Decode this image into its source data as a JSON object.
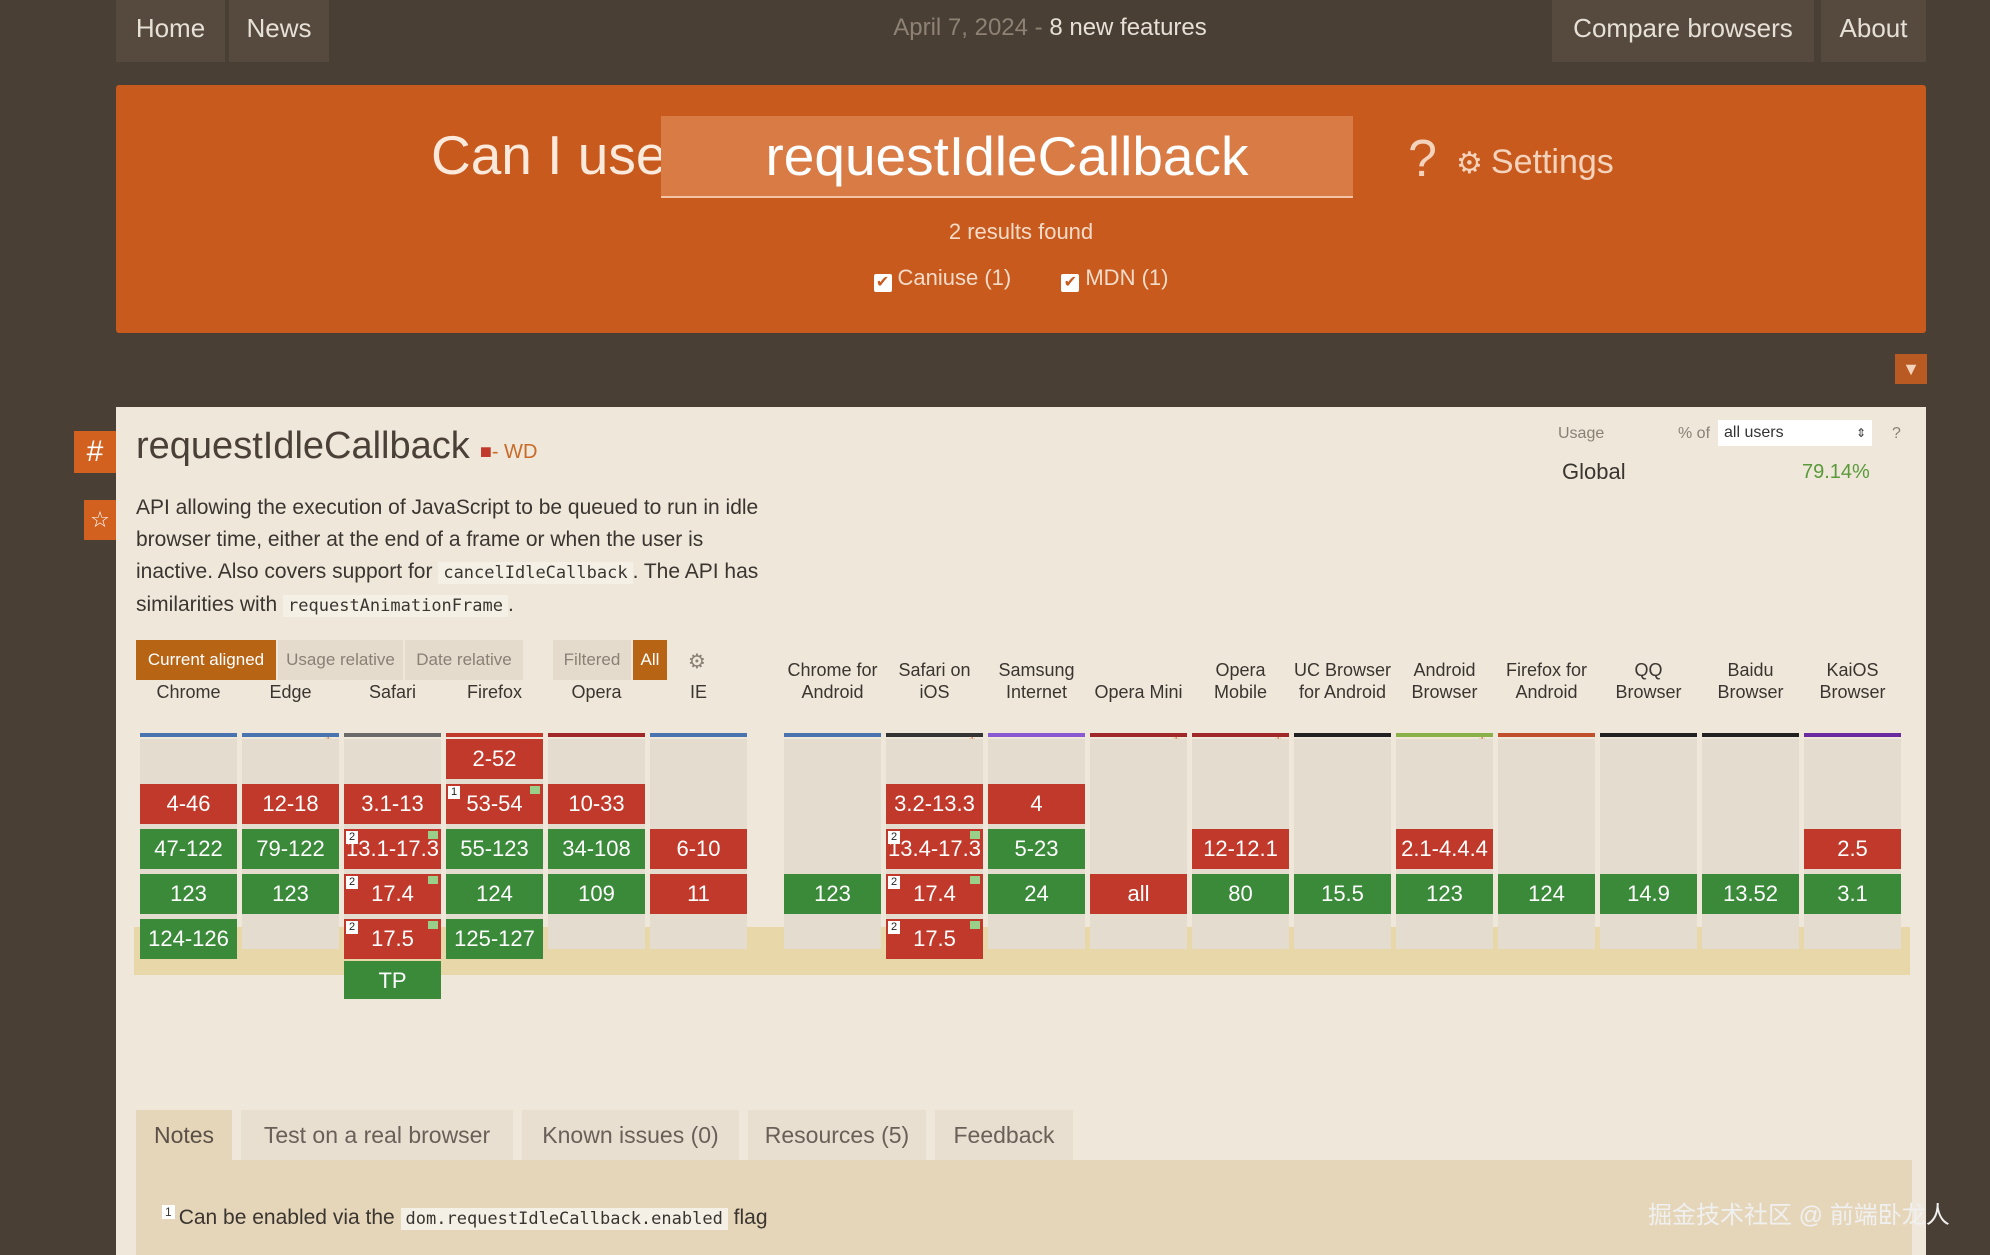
{
  "nav": {
    "home": "Home",
    "news": "News",
    "date": "April 7, 2024",
    "sep": " - ",
    "new_features": "8 new features",
    "compare": "Compare browsers",
    "about": "About"
  },
  "search": {
    "prefix": "Can I use",
    "query": "requestIdleCallback",
    "qmark": "?",
    "settings": "Settings",
    "results": "2 results found",
    "filters": [
      "Caniuse (1)",
      "MDN (1)"
    ]
  },
  "feature": {
    "title": "requestIdleCallback",
    "status": "- WD",
    "desc1": "API allowing the execution of JavaScript to be queued to run in idle browser time, either at the end of a frame or when the user is inactive. Also covers support for",
    "code1": "cancelIdleCallback",
    "desc2": ". The API has similarities with",
    "code2": "requestAnimationFrame",
    "desc3": "."
  },
  "usage": {
    "label": "Usage",
    "pct_of": "% of",
    "selector": "all users",
    "help": "?",
    "region": "Global",
    "value": "79.14%"
  },
  "view": {
    "current_aligned": "Current aligned",
    "usage_relative": "Usage relative",
    "date_relative": "Date relative",
    "filtered": "Filtered",
    "all": "All"
  },
  "browsers": [
    {
      "name": "Chrome",
      "star": false,
      "color": "#4a74b0"
    },
    {
      "name": "Edge",
      "star": true,
      "color": "#4a74b0"
    },
    {
      "name": "Safari",
      "star": false,
      "color": "#6a6a6a"
    },
    {
      "name": "Firefox",
      "star": false,
      "color": "#c0392b"
    },
    {
      "name": "Opera",
      "star": false,
      "color": "#a02828"
    },
    {
      "name": "IE",
      "star": false,
      "color": "#4a74b0"
    },
    {
      "name": "Chrome for Android",
      "star": false,
      "color": "#4a74b0"
    },
    {
      "name": "Safari on iOS",
      "star": true,
      "color": "#333333"
    },
    {
      "name": "Samsung Internet",
      "star": false,
      "color": "#8a5ad0"
    },
    {
      "name": "Opera Mini",
      "star": true,
      "color": "#a02828"
    },
    {
      "name": "Opera Mobile",
      "star": true,
      "color": "#a02828"
    },
    {
      "name": "UC Browser for Android",
      "star": false,
      "color": "#222222"
    },
    {
      "name": "Android Browser",
      "star": true,
      "color": "#8ab04a"
    },
    {
      "name": "Firefox for Android",
      "star": false,
      "color": "#c0502b"
    },
    {
      "name": "QQ Browser",
      "star": false,
      "color": "#222222"
    },
    {
      "name": "Baidu Browser",
      "star": false,
      "color": "#222222"
    },
    {
      "name": "KaiOS Browser",
      "star": false,
      "color": "#6a2aa0"
    }
  ],
  "support": [
    [
      null,
      "n:4-46",
      "y:47-122",
      "y:123",
      "y:124-126",
      null
    ],
    [
      null,
      "n:12-18",
      "y:79-122",
      "y:123",
      null,
      null
    ],
    [
      null,
      "n:3.1-13",
      "n:13.1-17.3:2:f",
      "n:17.4:2:f",
      "n:17.5:2:f",
      "y:TP"
    ],
    [
      "n:2-52",
      "n:53-54:1:f",
      "y:55-123",
      "y:124",
      "y:125-127",
      null
    ],
    [
      null,
      "n:10-33",
      "y:34-108",
      "y:109",
      null,
      null
    ],
    [
      null,
      null,
      "n:6-10",
      "n:11",
      null,
      null
    ],
    [
      null,
      null,
      null,
      "y:123",
      null,
      null
    ],
    [
      null,
      "n:3.2-13.3",
      "n:13.4-17.3:2:f",
      "n:17.4:2:f",
      "n:17.5:2:f",
      null
    ],
    [
      null,
      "n:4",
      "y:5-23",
      "y:24",
      null,
      null
    ],
    [
      null,
      null,
      null,
      "n:all",
      null,
      null
    ],
    [
      null,
      null,
      "n:12-12.1",
      "y:80",
      null,
      null
    ],
    [
      null,
      null,
      null,
      "y:15.5",
      null,
      null
    ],
    [
      null,
      null,
      "n:2.1-4.4.4",
      "y:123",
      null,
      null
    ],
    [
      null,
      null,
      null,
      "y:124",
      null,
      null
    ],
    [
      null,
      null,
      null,
      "y:14.9",
      null,
      null
    ],
    [
      null,
      null,
      null,
      "y:13.52",
      null,
      null
    ],
    [
      null,
      null,
      "n:2.5",
      "y:3.1",
      null,
      null
    ]
  ],
  "tabs": [
    "Notes",
    "Test on a real browser",
    "Known issues (0)",
    "Resources (5)",
    "Feedback"
  ],
  "note": {
    "num": "1",
    "pre": "Can be enabled via the",
    "code": "dom.requestIdleCallback.enabled",
    "post": "flag"
  },
  "watermark": "掘金技术社区 @ 前端卧龙人"
}
